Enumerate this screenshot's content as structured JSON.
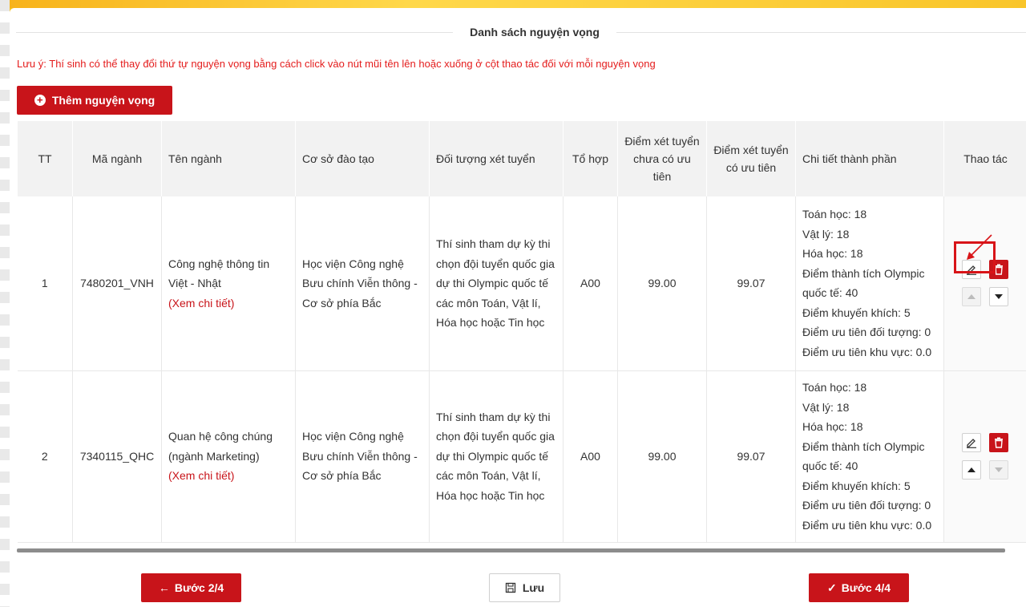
{
  "section": {
    "title": "Danh sách nguyện vọng",
    "note": "Lưu ý: Thí sinh có thể thay đổi thứ tự nguyện vọng bằng cách click vào nút mũi tên lên hoặc xuống ở cột thao tác đối với mỗi nguyện vọng",
    "add_button": "Thêm nguyện vọng"
  },
  "table": {
    "headers": {
      "tt": "TT",
      "ma_nganh": "Mã ngành",
      "ten_nganh": "Tên ngành",
      "co_so": "Cơ sở đào tạo",
      "doi_tuong": "Đối tượng xét tuyển",
      "to_hop": "Tổ hợp",
      "diem_chua_uu_tien": "Điểm xét tuyển chưa có ưu tiên",
      "diem_co_uu_tien": "Điểm xét tuyển có ưu tiên",
      "chi_tiet": "Chi tiết thành phần",
      "thao_tac": "Thao tác"
    },
    "rows": [
      {
        "tt": "1",
        "ma_nganh": "7480201_VNH",
        "ten_nganh": "Công nghệ thông tin Việt - Nhật",
        "xem_chi_tiet": "(Xem chi tiết)",
        "co_so": "Học viện Công nghệ Bưu chính Viễn thông - Cơ sở phía Bắc",
        "doi_tuong": "Thí sinh tham dự kỳ thi chọn đội tuyển quốc gia dự thi Olympic quốc tế các môn Toán, Vật lí, Hóa học hoặc Tin học",
        "to_hop": "A00",
        "diem_chua_uu_tien": "99.00",
        "diem_co_uu_tien": "99.07",
        "chi_tiet": [
          "Toán học: 18",
          "Vật lý: 18",
          "Hóa học: 18",
          "Điểm thành tích Olympic",
          "quốc tế: 40",
          "Điểm khuyến khích: 5",
          "Điểm ưu tiên đối tượng: 0",
          "Điểm ưu tiên khu vực: 0.0"
        ]
      },
      {
        "tt": "2",
        "ma_nganh": "7340115_QHC",
        "ten_nganh": "Quan hệ công chúng (ngành Marketing)",
        "xem_chi_tiet": "(Xem chi tiết)",
        "co_so": "Học viện Công nghệ Bưu chính Viễn thông - Cơ sở phía Bắc",
        "doi_tuong": "Thí sinh tham dự kỳ thi chọn đội tuyển quốc gia dự thi Olympic quốc tế các môn Toán, Vật lí, Hóa học hoặc Tin học",
        "to_hop": "A00",
        "diem_chua_uu_tien": "99.00",
        "diem_co_uu_tien": "99.07",
        "chi_tiet": [
          "Toán học: 18",
          "Vật lý: 18",
          "Hóa học: 18",
          "Điểm thành tích Olympic",
          "quốc tế: 40",
          "Điểm khuyến khích: 5",
          "Điểm ưu tiên đối tượng: 0",
          "Điểm ưu tiên khu vực: 0.0"
        ]
      }
    ]
  },
  "footer": {
    "prev_button": "Bước 2/4",
    "save_button": "Lưu",
    "next_button": "Bước 4/4"
  },
  "icons": {
    "add": "plus-circle-icon",
    "edit": "pencil-icon",
    "delete": "trash-icon",
    "move_up": "arrow-up-icon",
    "move_down": "arrow-down-icon",
    "prev": "arrow-left-icon",
    "save": "floppy-disk-icon",
    "next": "checkmark-icon"
  },
  "colors": {
    "primary_red": "#c8141a",
    "note_red": "#e41c1c",
    "header_bg": "#f2f2f2",
    "page_accent_yellow": "#f6c21c"
  }
}
